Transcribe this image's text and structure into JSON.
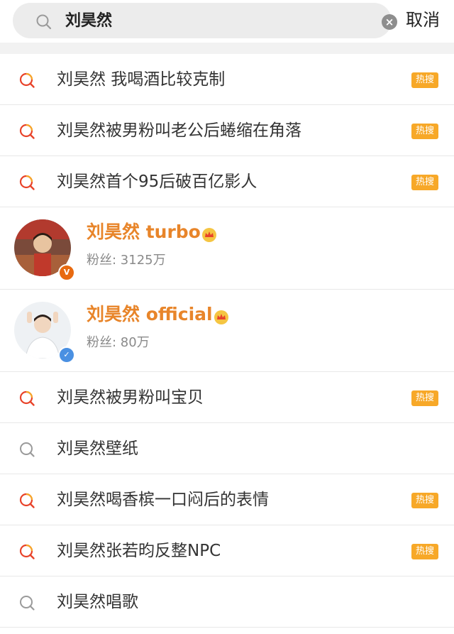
{
  "search": {
    "query": "刘昊然",
    "cancel_label": "取消"
  },
  "items": [
    {
      "kind": "suggest",
      "text": "刘昊然 我喝酒比较克制",
      "hot": true,
      "hot_label": "热搜"
    },
    {
      "kind": "suggest",
      "text": "刘昊然被男粉叫老公后蜷缩在角落",
      "hot": true,
      "hot_label": "热搜"
    },
    {
      "kind": "suggest",
      "text": "刘昊然首个95后破百亿影人",
      "hot": true,
      "hot_label": "热搜"
    },
    {
      "kind": "user",
      "name": "刘昊然 turbo",
      "fans": "粉丝: 3125万",
      "verified": "orange"
    },
    {
      "kind": "user",
      "name": "刘昊然 official",
      "fans": "粉丝: 80万",
      "verified": "blue"
    },
    {
      "kind": "suggest",
      "text": "刘昊然被男粉叫宝贝",
      "hot": true,
      "hot_label": "热搜"
    },
    {
      "kind": "suggest",
      "text": "刘昊然壁纸",
      "hot": false
    },
    {
      "kind": "suggest",
      "text": "刘昊然喝香槟一口闷后的表情",
      "hot": true,
      "hot_label": "热搜"
    },
    {
      "kind": "suggest",
      "text": "刘昊然张若昀反整NPC",
      "hot": true,
      "hot_label": "热搜"
    },
    {
      "kind": "suggest",
      "text": "刘昊然唱歌",
      "hot": false
    }
  ],
  "colors": {
    "hot_badge": "#f7a828",
    "username": "#e8852a",
    "verify_orange": "#e86a10",
    "verify_blue": "#4a90e2"
  },
  "icons": {
    "search": "search-icon",
    "hot_search": "hot-search-icon",
    "clear": "clear-icon",
    "crown": "crown-icon"
  }
}
